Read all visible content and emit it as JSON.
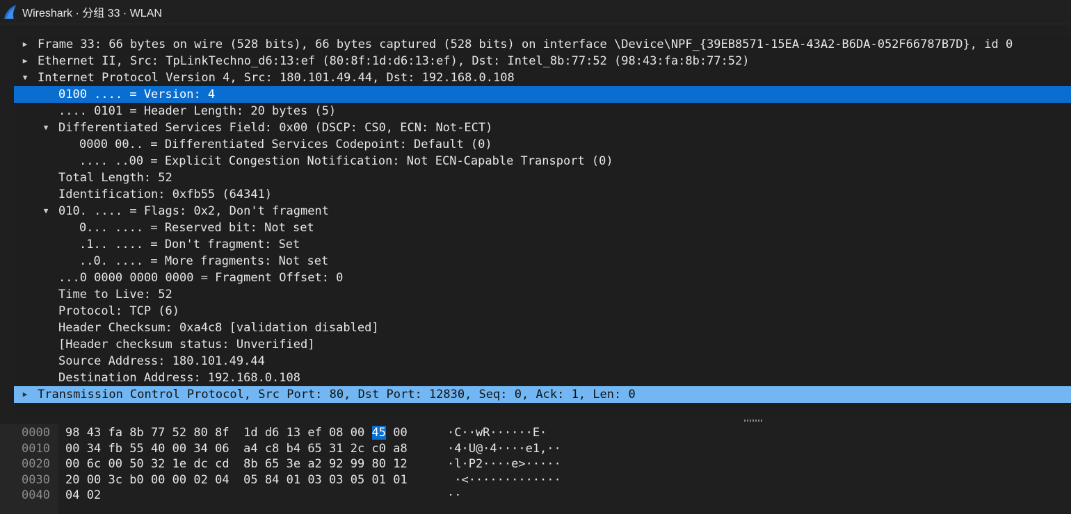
{
  "window": {
    "title": "Wireshark · 分组 33 · WLAN",
    "accent": "#0a6ed1",
    "highlight": "#72b7f3",
    "icon": "wireshark-fin-icon"
  },
  "tree": [
    {
      "expander": "collapsed",
      "text": "Frame 33: 66 bytes on wire (528 bits), 66 bytes captured (528 bits) on interface \\Device\\NPF_{39EB8571-15EA-43A2-B6DA-052F66787B7D}, id 0"
    },
    {
      "expander": "collapsed",
      "text": "Ethernet II, Src: TpLinkTechno_d6:13:ef (80:8f:1d:d6:13:ef), Dst: Intel_8b:77:52 (98:43:fa:8b:77:52)"
    },
    {
      "expander": "expanded",
      "text": "Internet Protocol Version 4, Src: 180.101.49.44, Dst: 192.168.0.108"
    },
    {
      "expander": "none",
      "text": "0100 .... = Version: 4",
      "state": "selected"
    },
    {
      "expander": "none",
      "text": ".... 0101 = Header Length: 20 bytes (5)"
    },
    {
      "expander": "expanded",
      "text": "Differentiated Services Field: 0x00 (DSCP: CS0, ECN: Not-ECT)"
    },
    {
      "expander": "none",
      "text": "0000 00.. = Differentiated Services Codepoint: Default (0)"
    },
    {
      "expander": "none",
      "text": ".... ..00 = Explicit Congestion Notification: Not ECN-Capable Transport (0)"
    },
    {
      "expander": "none",
      "text": "Total Length: 52"
    },
    {
      "expander": "none",
      "text": "Identification: 0xfb55 (64341)"
    },
    {
      "expander": "expanded",
      "text": "010. .... = Flags: 0x2, Don't fragment"
    },
    {
      "expander": "none",
      "text": "0... .... = Reserved bit: Not set"
    },
    {
      "expander": "none",
      "text": ".1.. .... = Don't fragment: Set"
    },
    {
      "expander": "none",
      "text": "..0. .... = More fragments: Not set"
    },
    {
      "expander": "none",
      "text": "...0 0000 0000 0000 = Fragment Offset: 0"
    },
    {
      "expander": "none",
      "text": "Time to Live: 52"
    },
    {
      "expander": "none",
      "text": "Protocol: TCP (6)"
    },
    {
      "expander": "none",
      "text": "Header Checksum: 0xa4c8 [validation disabled]"
    },
    {
      "expander": "none",
      "text": "[Header checksum status: Unverified]"
    },
    {
      "expander": "none",
      "text": "Source Address: 180.101.49.44"
    },
    {
      "expander": "none",
      "text": "Destination Address: 192.168.0.108"
    },
    {
      "expander": "collapsed",
      "text": "Transmission Control Protocol, Src Port: 80, Dst Port: 12830, Seq: 0, Ack: 1, Len: 0",
      "state": "highlighted"
    }
  ],
  "hex": [
    {
      "offset": "0000",
      "bytes": [
        "98",
        "43",
        "fa",
        "8b",
        "77",
        "52",
        "80",
        "8f",
        "1d",
        "d6",
        "13",
        "ef",
        "08",
        "00",
        "45",
        "00"
      ],
      "ascii": "·C··wR······E·"
    },
    {
      "offset": "0010",
      "bytes": [
        "00",
        "34",
        "fb",
        "55",
        "40",
        "00",
        "34",
        "06",
        "a4",
        "c8",
        "b4",
        "65",
        "31",
        "2c",
        "c0",
        "a8"
      ],
      "ascii": "·4·U@·4····e1,··"
    },
    {
      "offset": "0020",
      "bytes": [
        "00",
        "6c",
        "00",
        "50",
        "32",
        "1e",
        "dc",
        "cd",
        "8b",
        "65",
        "3e",
        "a2",
        "92",
        "99",
        "80",
        "12"
      ],
      "ascii": "·l·P2····e>·····"
    },
    {
      "offset": "0030",
      "bytes": [
        "20",
        "00",
        "3c",
        "b0",
        "00",
        "00",
        "02",
        "04",
        "05",
        "84",
        "01",
        "03",
        "03",
        "05",
        "01",
        "01"
      ],
      "ascii": " ·<·············"
    },
    {
      "offset": "0040",
      "bytes": [
        "04",
        "02"
      ],
      "ascii": "··"
    }
  ],
  "hex_selection": {
    "row": 0,
    "byte": 14
  }
}
